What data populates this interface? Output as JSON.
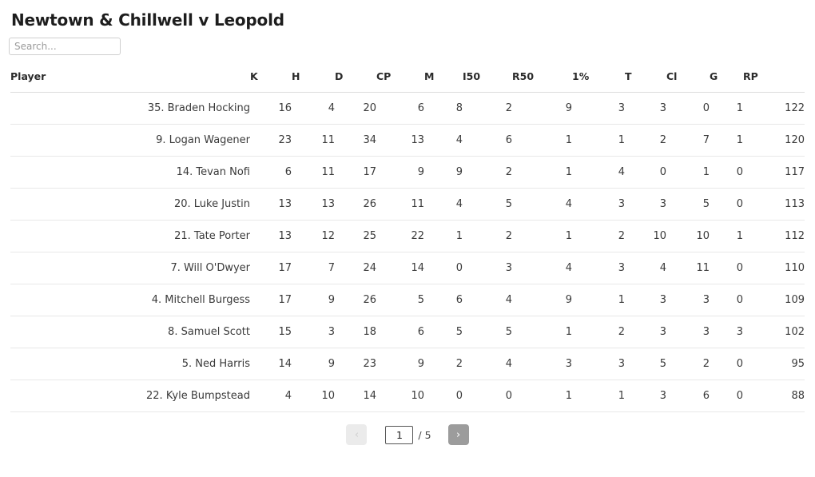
{
  "header": {
    "title": "Newtown & Chillwell v Leopold"
  },
  "search": {
    "placeholder": "Search...",
    "value": ""
  },
  "table": {
    "columns": [
      {
        "key": "player",
        "label": "Player"
      },
      {
        "key": "k",
        "label": "K"
      },
      {
        "key": "h",
        "label": "H"
      },
      {
        "key": "d",
        "label": "D"
      },
      {
        "key": "cp",
        "label": "CP"
      },
      {
        "key": "m",
        "label": "M"
      },
      {
        "key": "i50",
        "label": "I50"
      },
      {
        "key": "r50",
        "label": "R50"
      },
      {
        "key": "onepct",
        "label": "1%"
      },
      {
        "key": "t",
        "label": "T"
      },
      {
        "key": "cl",
        "label": "Cl"
      },
      {
        "key": "g",
        "label": "G"
      },
      {
        "key": "rp",
        "label": "RP"
      }
    ],
    "rows": [
      {
        "player": "35. Braden Hocking",
        "k": "16",
        "h": "4",
        "d": "20",
        "cp": "6",
        "m": "8",
        "i50": "2",
        "r50": "9",
        "onepct": "3",
        "t": "3",
        "cl": "0",
        "g": "1",
        "rp": "122"
      },
      {
        "player": "9. Logan Wagener",
        "k": "23",
        "h": "11",
        "d": "34",
        "cp": "13",
        "m": "4",
        "i50": "6",
        "r50": "1",
        "onepct": "1",
        "t": "2",
        "cl": "7",
        "g": "1",
        "rp": "120"
      },
      {
        "player": "14. Tevan Nofi",
        "k": "6",
        "h": "11",
        "d": "17",
        "cp": "9",
        "m": "9",
        "i50": "2",
        "r50": "1",
        "onepct": "4",
        "t": "0",
        "cl": "1",
        "g": "0",
        "rp": "117"
      },
      {
        "player": "20. Luke Justin",
        "k": "13",
        "h": "13",
        "d": "26",
        "cp": "11",
        "m": "4",
        "i50": "5",
        "r50": "4",
        "onepct": "3",
        "t": "3",
        "cl": "5",
        "g": "0",
        "rp": "113"
      },
      {
        "player": "21. Tate Porter",
        "k": "13",
        "h": "12",
        "d": "25",
        "cp": "22",
        "m": "1",
        "i50": "2",
        "r50": "1",
        "onepct": "2",
        "t": "10",
        "cl": "10",
        "g": "1",
        "rp": "112"
      },
      {
        "player": "7. Will O'Dwyer",
        "k": "17",
        "h": "7",
        "d": "24",
        "cp": "14",
        "m": "0",
        "i50": "3",
        "r50": "4",
        "onepct": "3",
        "t": "4",
        "cl": "11",
        "g": "0",
        "rp": "110"
      },
      {
        "player": "4. Mitchell Burgess",
        "k": "17",
        "h": "9",
        "d": "26",
        "cp": "5",
        "m": "6",
        "i50": "4",
        "r50": "9",
        "onepct": "1",
        "t": "3",
        "cl": "3",
        "g": "0",
        "rp": "109"
      },
      {
        "player": "8. Samuel Scott",
        "k": "15",
        "h": "3",
        "d": "18",
        "cp": "6",
        "m": "5",
        "i50": "5",
        "r50": "1",
        "onepct": "2",
        "t": "3",
        "cl": "3",
        "g": "3",
        "rp": "102"
      },
      {
        "player": "5. Ned Harris",
        "k": "14",
        "h": "9",
        "d": "23",
        "cp": "9",
        "m": "2",
        "i50": "4",
        "r50": "3",
        "onepct": "3",
        "t": "5",
        "cl": "2",
        "g": "0",
        "rp": "95"
      },
      {
        "player": "22. Kyle Bumpstead",
        "k": "4",
        "h": "10",
        "d": "14",
        "cp": "10",
        "m": "0",
        "i50": "0",
        "r50": "1",
        "onepct": "1",
        "t": "3",
        "cl": "6",
        "g": "0",
        "rp": "88"
      }
    ]
  },
  "pagination": {
    "prev_label": "‹",
    "next_label": "›",
    "current_page": "1",
    "total_label": "/ 5",
    "total_pages": "5"
  }
}
